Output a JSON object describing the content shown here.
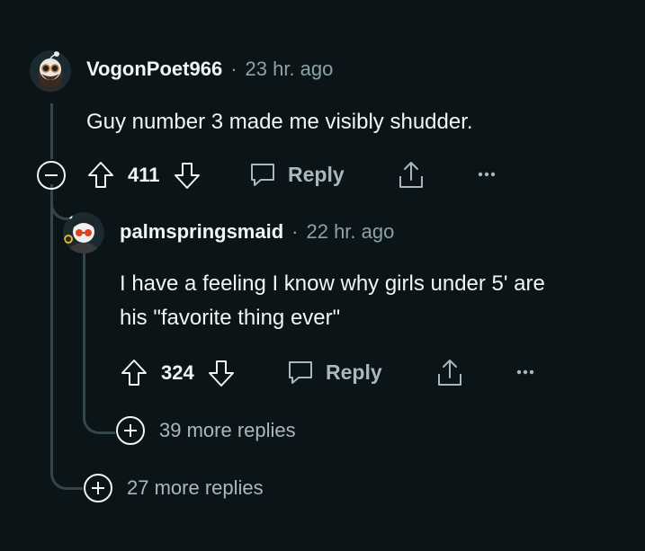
{
  "comments": [
    {
      "username": "VogonPoet966",
      "separator": "·",
      "timestamp": "23 hr. ago",
      "body": "Guy number 3 made me visibly shudder.",
      "votes": "411",
      "reply_label": "Reply"
    },
    {
      "username": "palmspringsmaid",
      "separator": "·",
      "timestamp": "22 hr. ago",
      "body_line1": "I have a feeling I know why girls under 5' are",
      "body_line2": "his \"favorite thing ever\"",
      "votes": "324",
      "reply_label": "Reply"
    }
  ],
  "more_replies_nested": "39 more replies",
  "more_replies_top": "27 more replies",
  "icons": [
    "collapse-icon",
    "upvote-icon",
    "downvote-icon",
    "comment-icon",
    "share-icon",
    "overflow-menu-icon",
    "expand-icon"
  ],
  "colors": {
    "background": "#0b1416",
    "text": "#f2f4f5",
    "muted": "#8ba2ad",
    "thread_line": "#33464c"
  }
}
